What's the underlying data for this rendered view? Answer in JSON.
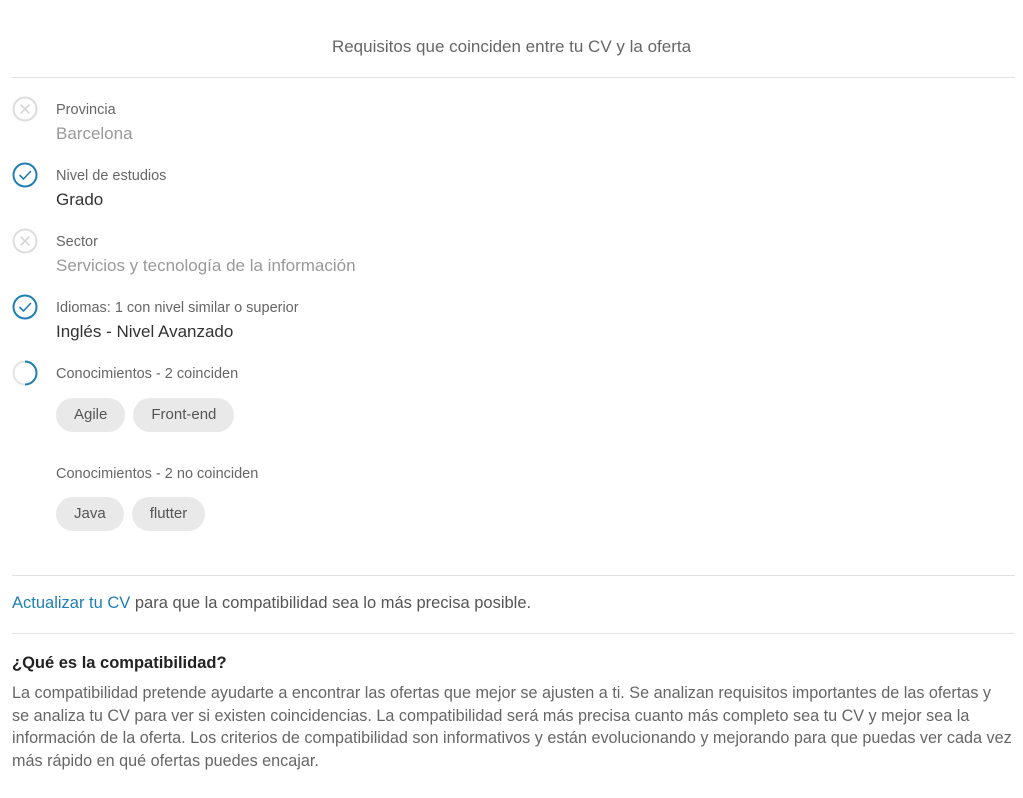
{
  "header": {
    "title": "Requisitos que coinciden entre tu CV y la oferta"
  },
  "requirements": [
    {
      "status": "no",
      "label": "Provincia",
      "value": "Barcelona"
    },
    {
      "status": "yes",
      "label": "Nivel de estudios",
      "value": "Grado"
    },
    {
      "status": "no",
      "label": "Sector",
      "value": "Servicios y tecnología de la información"
    },
    {
      "status": "yes",
      "label": "Idiomas: 1 con nivel similar o superior",
      "value": "Inglés - Nivel Avanzado"
    }
  ],
  "skills": {
    "matched": {
      "status": "partial",
      "label": "Conocimientos - 2 coinciden",
      "tags": [
        "Agile",
        "Front-end"
      ]
    },
    "unmatched": {
      "label": "Conocimientos - 2 no coinciden",
      "tags": [
        "Java",
        "flutter"
      ]
    }
  },
  "update_cv": {
    "link_label": "Actualizar tu CV",
    "text": " para que la compatibilidad sea lo más precisa posible."
  },
  "faq": {
    "title": "¿Qué es la compatibilidad?",
    "text": "La compatibilidad pretende ayudarte a encontrar las ofertas que mejor se ajusten a ti. Se analizan requisitos importantes de las ofertas y se analiza tu CV para ver si existen coincidencias. La compatibilidad será más precisa cuanto más completo sea tu CV y mejor sea la información de la oferta. Los criterios de compatibilidad son informativos y están evolucionando y mejorando para que puedas ver cada vez más rápido en qué ofertas puedes encajar."
  },
  "colors": {
    "accent": "#1f7fb4",
    "muted_icon": "#dddddd",
    "tag_bg": "#e9e9e9"
  },
  "icons": {
    "no": "x-circle-icon",
    "yes": "check-circle-icon",
    "partial": "partial-circle-icon"
  }
}
